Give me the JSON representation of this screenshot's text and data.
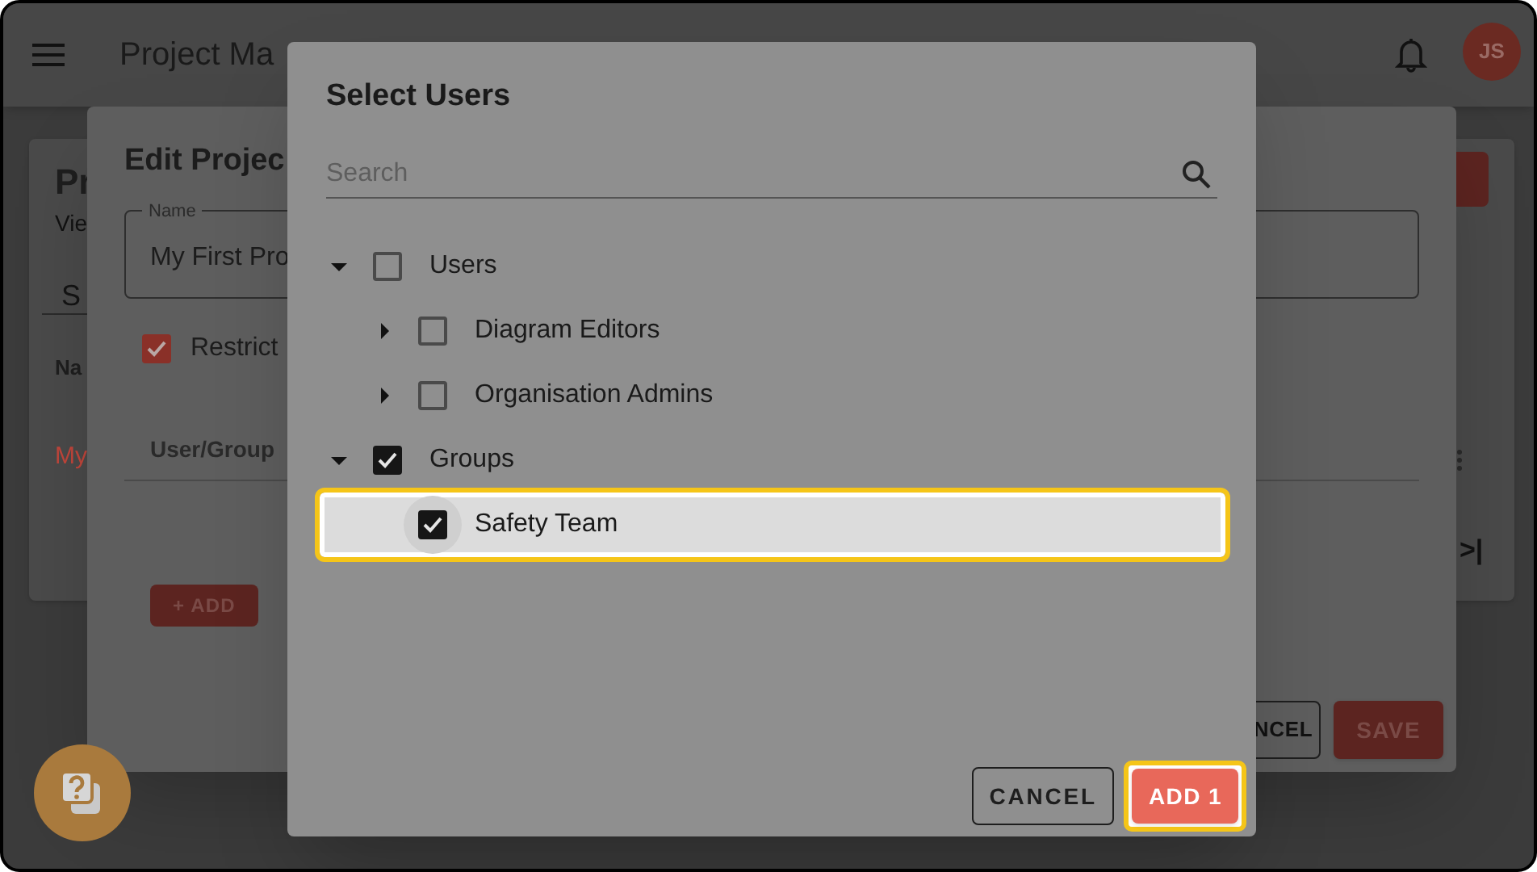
{
  "app_bar": {
    "title": "Project Ma",
    "avatar_initials": "JS"
  },
  "background_page": {
    "title_fragment": "Pr",
    "subtitle_fragment": "Vie",
    "search_fragment": "S",
    "column_fragment": "Na",
    "row_fragment": "My",
    "pagination_fragment": ">|"
  },
  "edit_dialog": {
    "title": "Edit Projec",
    "name_field": {
      "label": "Name",
      "value": "My First Pro"
    },
    "restrict": {
      "label": "Restrict",
      "checked": true
    },
    "table": {
      "columns": [
        "User/Group"
      ]
    },
    "add_button": "+ ADD",
    "buttons": [
      {
        "label": "NCEL",
        "kind": "outlined"
      },
      {
        "label": "SAVE",
        "kind": "primary"
      }
    ]
  },
  "select_dialog": {
    "title": "Select Users",
    "search": {
      "placeholder": "Search"
    },
    "tree": [
      {
        "label": "Users",
        "expanded": true,
        "checked": false,
        "highlighted": false,
        "children": [
          {
            "label": "Diagram Editors",
            "expanded": false,
            "checked": false,
            "highlighted": false
          },
          {
            "label": "Organisation Admins",
            "expanded": false,
            "checked": false,
            "highlighted": false
          }
        ]
      },
      {
        "label": "Groups",
        "expanded": true,
        "checked": true,
        "highlighted": false,
        "children": [
          {
            "label": "Safety Team",
            "checked": true,
            "highlighted": true
          }
        ]
      }
    ],
    "buttons": [
      {
        "label": "CANCEL",
        "kind": "outlined",
        "highlighted": false
      },
      {
        "label": "ADD 1",
        "kind": "primary",
        "highlighted": true
      }
    ]
  }
}
